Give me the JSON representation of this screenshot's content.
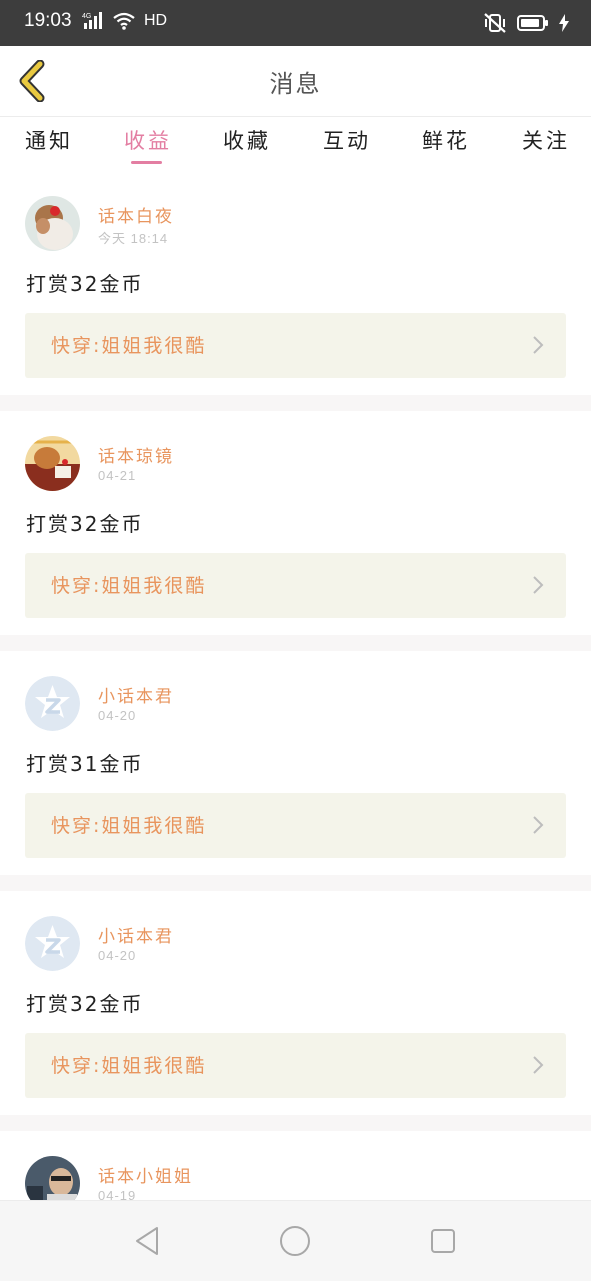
{
  "status_bar": {
    "time": "19:03",
    "network": "4G",
    "hd": "HD",
    "icons": [
      "signal-icon",
      "wifi-icon",
      "mute-vibrate-icon",
      "battery-icon",
      "charging-icon"
    ]
  },
  "header": {
    "title": "消息",
    "back_icon": "chevron-left-icon",
    "accent_color": "#e9c940"
  },
  "tabs": {
    "items": [
      {
        "label": "通知"
      },
      {
        "label": "收益",
        "active": true
      },
      {
        "label": "收藏"
      },
      {
        "label": "互动"
      },
      {
        "label": "鲜花"
      },
      {
        "label": "关注"
      }
    ],
    "active_color": "#e37ea2"
  },
  "messages": [
    {
      "user": "话本白夜",
      "time": "今天 18:14",
      "text": "打赏32金币",
      "book": "快穿:姐姐我很酷"
    },
    {
      "user": "话本琼镜",
      "time": "04-21",
      "text": "打赏32金币",
      "book": "快穿:姐姐我很酷"
    },
    {
      "user": "小话本君",
      "time": "04-20",
      "text": "打赏31金币",
      "book": "快穿:姐姐我很酷"
    },
    {
      "user": "小话本君",
      "time": "04-20",
      "text": "打赏32金币",
      "book": "快穿:姐姐我很酷"
    },
    {
      "user": "话本小姐姐",
      "time": "04-19",
      "text": "",
      "book": ""
    }
  ],
  "colors": {
    "username": "#e8955e",
    "book_bg": "#f4f4ea",
    "status_bar": "#3d3d3d"
  },
  "nav": {
    "back": "triangle-back-icon",
    "home": "circle-home-icon",
    "recents": "square-recents-icon"
  }
}
